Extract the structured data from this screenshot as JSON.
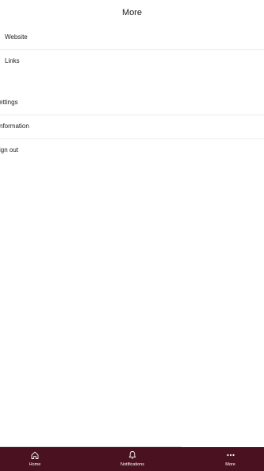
{
  "header": {
    "title": "More"
  },
  "menu": {
    "items": [
      {
        "label": "Website"
      },
      {
        "label": "Links"
      },
      {
        "label": "Settings",
        "visible_text": "ettings"
      },
      {
        "label": "Information",
        "visible_text": "nformation"
      },
      {
        "label": "Sign out",
        "visible_text": "ign out"
      }
    ]
  },
  "bottom_nav": {
    "items": [
      {
        "label": "Home",
        "icon": "home-icon"
      },
      {
        "label": "Notifications",
        "icon": "bell-icon"
      },
      {
        "label": "More",
        "icon": "more-dots-icon"
      }
    ],
    "background_color": "#4a1220",
    "text_color": "#ffffff"
  }
}
